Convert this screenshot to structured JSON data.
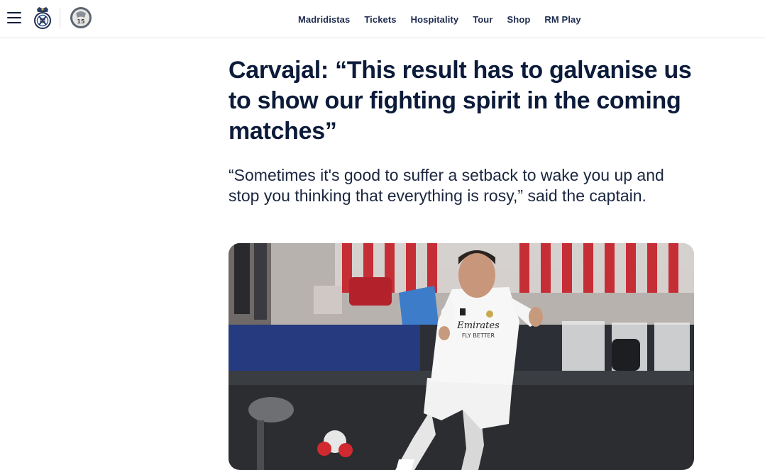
{
  "header": {
    "nav": [
      {
        "label": "Madridistas"
      },
      {
        "label": "Tickets"
      },
      {
        "label": "Hospitality"
      },
      {
        "label": "Tour"
      },
      {
        "label": "Shop"
      },
      {
        "label": "RM Play"
      }
    ],
    "badge_number": "15"
  },
  "article": {
    "title": "Carvajal: “This result has to galvanise us to show our fighting spirit in the coming matches”",
    "subtitle": "“Sometimes it's good to suffer a setback to wake you up and stop you thinking that everything is rosy,” said the captain.",
    "image": {
      "subject": "player-photo",
      "shirt_text_line1": "Emirates",
      "shirt_text_line2": "FLY BETTER"
    }
  },
  "colors": {
    "primary": "#0c1b3a",
    "nav_text": "#1d2b4f",
    "border": "#e4e6ea"
  },
  "icons": {
    "menu": "hamburger-icon",
    "crest": "real-madrid-crest-icon",
    "badge": "fifteen-badge-icon"
  }
}
